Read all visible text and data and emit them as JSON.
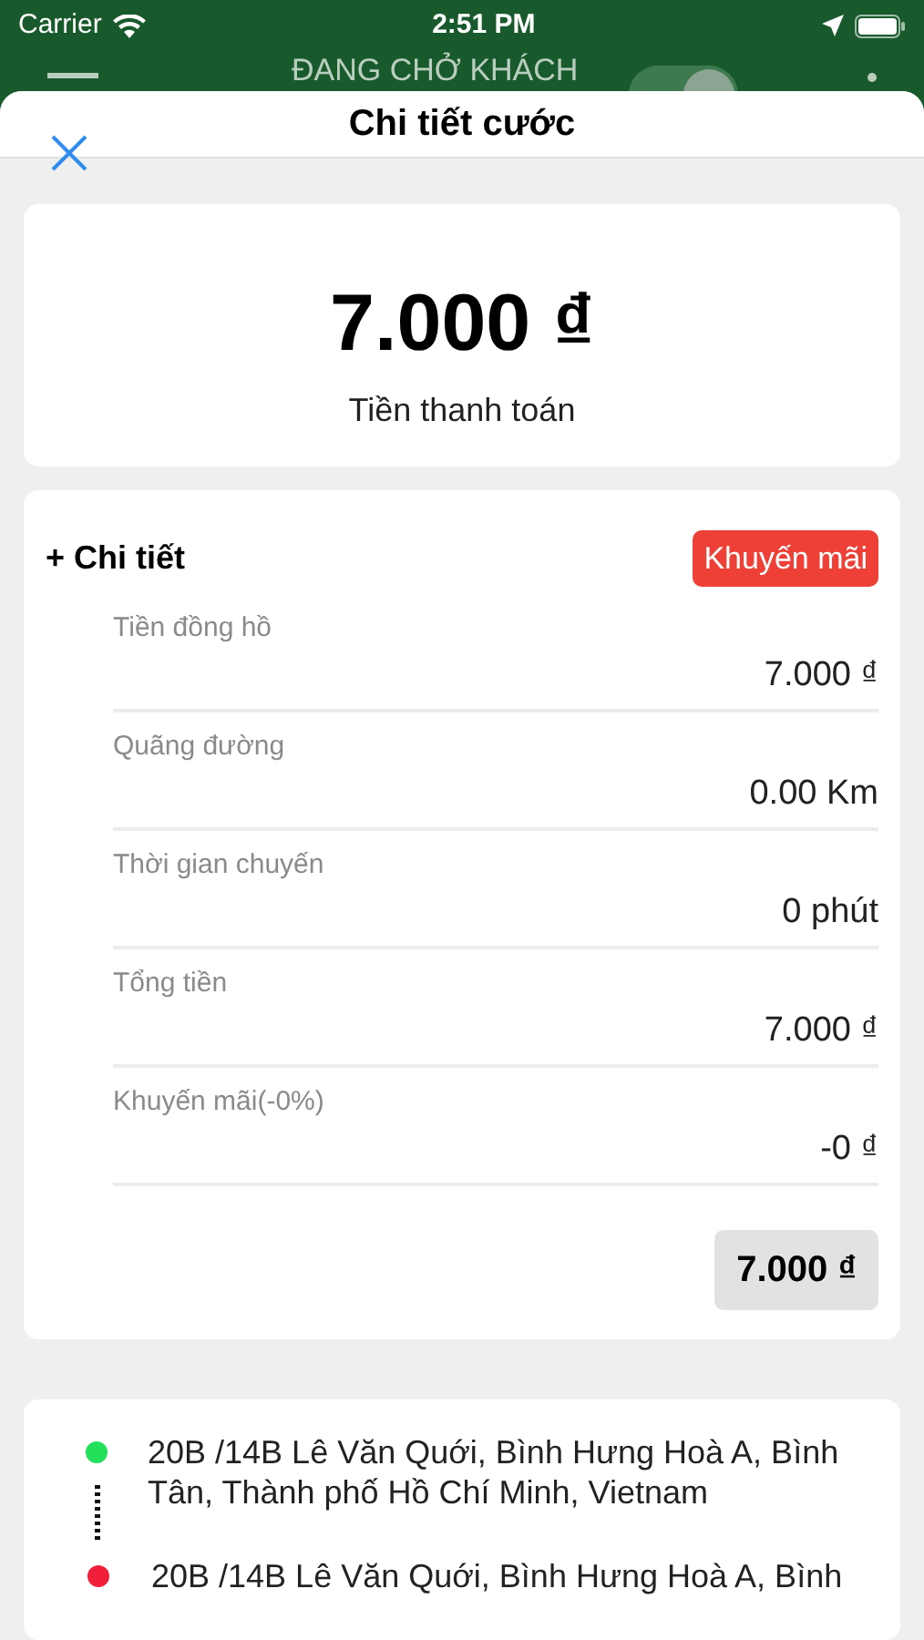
{
  "status_bar": {
    "carrier": "Carrier",
    "time": "2:51 PM"
  },
  "background_header": {
    "title": "ĐANG CHỞ KHÁCH",
    "toggle_on": true
  },
  "sheet": {
    "title": "Chi tiết cước"
  },
  "payment": {
    "amount": "7.000 ₫",
    "label": "Tiền thanh toán"
  },
  "details": {
    "title": "+ Chi tiết",
    "promo_badge": "Khuyến mãi",
    "rows": [
      {
        "label": "Tiền đồng hồ",
        "value": "7.000 ₫"
      },
      {
        "label": "Quãng đường",
        "value": "0.00 Km"
      },
      {
        "label": "Thời gian chuyến",
        "value": "0 phút"
      },
      {
        "label": "Tổng tiền",
        "value": "7.000 ₫"
      },
      {
        "label": "Khuyến mãi(-0%)",
        "value": "-0 ₫"
      }
    ],
    "total": "7.000 ₫"
  },
  "route": [
    {
      "address": "20B /14B Lê Văn Quới, Bình Hưng Hoà A, Bình Tân, Thành phố Hồ Chí Minh, Vietnam",
      "color": "#22e05a"
    },
    {
      "address": "20B /14B Lê Văn Quới, Bình Hưng Hoà A, Bình",
      "color": "#f0203a"
    }
  ]
}
